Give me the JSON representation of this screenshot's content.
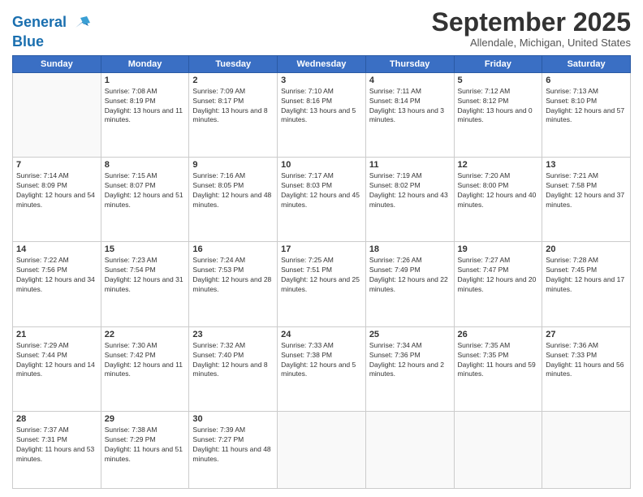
{
  "logo": {
    "line1": "General",
    "line2": "Blue"
  },
  "title": "September 2025",
  "location": "Allendale, Michigan, United States",
  "days_header": [
    "Sunday",
    "Monday",
    "Tuesday",
    "Wednesday",
    "Thursday",
    "Friday",
    "Saturday"
  ],
  "weeks": [
    [
      {
        "day": "",
        "sunrise": "",
        "sunset": "",
        "daylight": ""
      },
      {
        "day": "1",
        "sunrise": "Sunrise: 7:08 AM",
        "sunset": "Sunset: 8:19 PM",
        "daylight": "Daylight: 13 hours and 11 minutes."
      },
      {
        "day": "2",
        "sunrise": "Sunrise: 7:09 AM",
        "sunset": "Sunset: 8:17 PM",
        "daylight": "Daylight: 13 hours and 8 minutes."
      },
      {
        "day": "3",
        "sunrise": "Sunrise: 7:10 AM",
        "sunset": "Sunset: 8:16 PM",
        "daylight": "Daylight: 13 hours and 5 minutes."
      },
      {
        "day": "4",
        "sunrise": "Sunrise: 7:11 AM",
        "sunset": "Sunset: 8:14 PM",
        "daylight": "Daylight: 13 hours and 3 minutes."
      },
      {
        "day": "5",
        "sunrise": "Sunrise: 7:12 AM",
        "sunset": "Sunset: 8:12 PM",
        "daylight": "Daylight: 13 hours and 0 minutes."
      },
      {
        "day": "6",
        "sunrise": "Sunrise: 7:13 AM",
        "sunset": "Sunset: 8:10 PM",
        "daylight": "Daylight: 12 hours and 57 minutes."
      }
    ],
    [
      {
        "day": "7",
        "sunrise": "Sunrise: 7:14 AM",
        "sunset": "Sunset: 8:09 PM",
        "daylight": "Daylight: 12 hours and 54 minutes."
      },
      {
        "day": "8",
        "sunrise": "Sunrise: 7:15 AM",
        "sunset": "Sunset: 8:07 PM",
        "daylight": "Daylight: 12 hours and 51 minutes."
      },
      {
        "day": "9",
        "sunrise": "Sunrise: 7:16 AM",
        "sunset": "Sunset: 8:05 PM",
        "daylight": "Daylight: 12 hours and 48 minutes."
      },
      {
        "day": "10",
        "sunrise": "Sunrise: 7:17 AM",
        "sunset": "Sunset: 8:03 PM",
        "daylight": "Daylight: 12 hours and 45 minutes."
      },
      {
        "day": "11",
        "sunrise": "Sunrise: 7:19 AM",
        "sunset": "Sunset: 8:02 PM",
        "daylight": "Daylight: 12 hours and 43 minutes."
      },
      {
        "day": "12",
        "sunrise": "Sunrise: 7:20 AM",
        "sunset": "Sunset: 8:00 PM",
        "daylight": "Daylight: 12 hours and 40 minutes."
      },
      {
        "day": "13",
        "sunrise": "Sunrise: 7:21 AM",
        "sunset": "Sunset: 7:58 PM",
        "daylight": "Daylight: 12 hours and 37 minutes."
      }
    ],
    [
      {
        "day": "14",
        "sunrise": "Sunrise: 7:22 AM",
        "sunset": "Sunset: 7:56 PM",
        "daylight": "Daylight: 12 hours and 34 minutes."
      },
      {
        "day": "15",
        "sunrise": "Sunrise: 7:23 AM",
        "sunset": "Sunset: 7:54 PM",
        "daylight": "Daylight: 12 hours and 31 minutes."
      },
      {
        "day": "16",
        "sunrise": "Sunrise: 7:24 AM",
        "sunset": "Sunset: 7:53 PM",
        "daylight": "Daylight: 12 hours and 28 minutes."
      },
      {
        "day": "17",
        "sunrise": "Sunrise: 7:25 AM",
        "sunset": "Sunset: 7:51 PM",
        "daylight": "Daylight: 12 hours and 25 minutes."
      },
      {
        "day": "18",
        "sunrise": "Sunrise: 7:26 AM",
        "sunset": "Sunset: 7:49 PM",
        "daylight": "Daylight: 12 hours and 22 minutes."
      },
      {
        "day": "19",
        "sunrise": "Sunrise: 7:27 AM",
        "sunset": "Sunset: 7:47 PM",
        "daylight": "Daylight: 12 hours and 20 minutes."
      },
      {
        "day": "20",
        "sunrise": "Sunrise: 7:28 AM",
        "sunset": "Sunset: 7:45 PM",
        "daylight": "Daylight: 12 hours and 17 minutes."
      }
    ],
    [
      {
        "day": "21",
        "sunrise": "Sunrise: 7:29 AM",
        "sunset": "Sunset: 7:44 PM",
        "daylight": "Daylight: 12 hours and 14 minutes."
      },
      {
        "day": "22",
        "sunrise": "Sunrise: 7:30 AM",
        "sunset": "Sunset: 7:42 PM",
        "daylight": "Daylight: 12 hours and 11 minutes."
      },
      {
        "day": "23",
        "sunrise": "Sunrise: 7:32 AM",
        "sunset": "Sunset: 7:40 PM",
        "daylight": "Daylight: 12 hours and 8 minutes."
      },
      {
        "day": "24",
        "sunrise": "Sunrise: 7:33 AM",
        "sunset": "Sunset: 7:38 PM",
        "daylight": "Daylight: 12 hours and 5 minutes."
      },
      {
        "day": "25",
        "sunrise": "Sunrise: 7:34 AM",
        "sunset": "Sunset: 7:36 PM",
        "daylight": "Daylight: 12 hours and 2 minutes."
      },
      {
        "day": "26",
        "sunrise": "Sunrise: 7:35 AM",
        "sunset": "Sunset: 7:35 PM",
        "daylight": "Daylight: 11 hours and 59 minutes."
      },
      {
        "day": "27",
        "sunrise": "Sunrise: 7:36 AM",
        "sunset": "Sunset: 7:33 PM",
        "daylight": "Daylight: 11 hours and 56 minutes."
      }
    ],
    [
      {
        "day": "28",
        "sunrise": "Sunrise: 7:37 AM",
        "sunset": "Sunset: 7:31 PM",
        "daylight": "Daylight: 11 hours and 53 minutes."
      },
      {
        "day": "29",
        "sunrise": "Sunrise: 7:38 AM",
        "sunset": "Sunset: 7:29 PM",
        "daylight": "Daylight: 11 hours and 51 minutes."
      },
      {
        "day": "30",
        "sunrise": "Sunrise: 7:39 AM",
        "sunset": "Sunset: 7:27 PM",
        "daylight": "Daylight: 11 hours and 48 minutes."
      },
      {
        "day": "",
        "sunrise": "",
        "sunset": "",
        "daylight": ""
      },
      {
        "day": "",
        "sunrise": "",
        "sunset": "",
        "daylight": ""
      },
      {
        "day": "",
        "sunrise": "",
        "sunset": "",
        "daylight": ""
      },
      {
        "day": "",
        "sunrise": "",
        "sunset": "",
        "daylight": ""
      }
    ]
  ]
}
